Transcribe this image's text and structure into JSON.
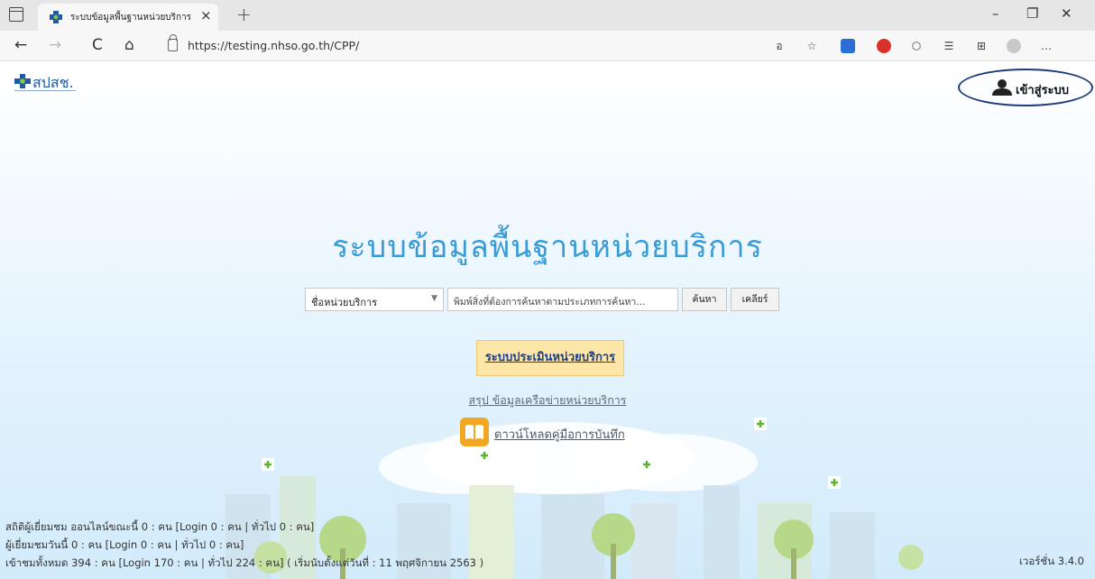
{
  "browser": {
    "tab_title": "ระบบข้อมูลพื้นฐานหน่วยบริการ",
    "tab_close": "×",
    "new_tab": "+",
    "window": {
      "minimize": "–",
      "restore": "❐",
      "close": "✕"
    },
    "url": "https://testing.nhso.go.th/CPP/",
    "nav": {
      "back": "←",
      "forward": "→",
      "refresh": "C",
      "home": "⌂"
    },
    "toolbar_icons": [
      "read-aloud-icon",
      "favorite-icon",
      "extension-icon",
      "adblock-icon",
      "extension-icon",
      "favorites-icon",
      "collections-icon",
      "profile-icon",
      "more-icon"
    ]
  },
  "header": {
    "logo_text": "สปสช.",
    "login_label": "เข้าสู่ระบบ"
  },
  "main": {
    "title": "ระบบข้อมูลพื้นฐานหน่วยบริการ",
    "search": {
      "select_value": "ชื่อหน่วยบริการ",
      "input_placeholder": "พิมพ์สิ่งที่ต้องการค้นหาตามประเภทการค้นหา...",
      "search_button": "ค้นหา",
      "clear_button": "เคลียร์"
    },
    "eval_button": "ระบบประเมินหน่วยบริการ",
    "summary_link": "สรุป ข้อมูลเครือข่ายหน่วยบริการ",
    "manual_link": "ดาวน์โหลดคู่มือการบันทึก"
  },
  "footer": {
    "stats_online": "สถิติผู้เยี่ยมชม ออนไลน์ขณะนี้ 0 : คน [Login 0 : คน | ทั่วไป 0 : คน]",
    "stats_today": "ผู้เยี่ยมชมวันนี้ 0 : คน [Login 0 : คน | ทั่วไป 0 : คน]",
    "stats_total": "เข้าชมทั้งหมด 394 : คน [Login 170 : คน | ทั่วไป 224 : คน] ( เริ่มนับตั้งแต่วันที่ : 11 พฤศจิกายน 2563 )",
    "version": "เวอร์ชั่น 3.4.0"
  },
  "colors": {
    "title": "#3a9bd4",
    "eval_bg": "#fde6a8",
    "login_ring": "#1f3c7a",
    "manual_icon": "#f1a722"
  }
}
